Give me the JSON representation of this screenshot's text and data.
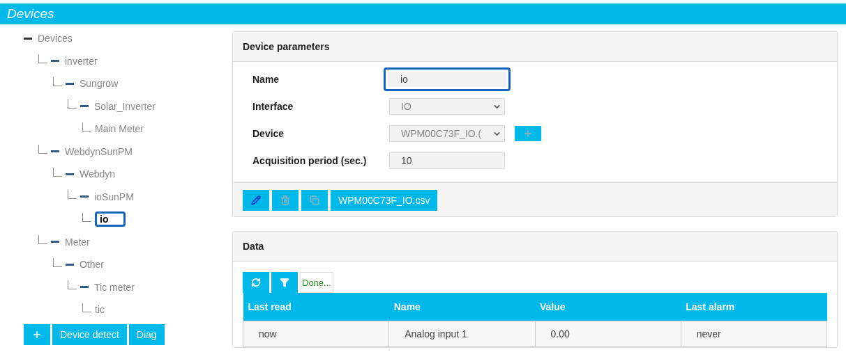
{
  "header": {
    "title": "Devices"
  },
  "tree": {
    "label": "Devices",
    "selected": false,
    "children": [
      {
        "label": "inverter",
        "selected": false,
        "children": [
          {
            "label": "Sungrow",
            "selected": false,
            "children": [
              {
                "label": "Solar_Inverter",
                "selected": false,
                "children": [
                  {
                    "label": "Main Meter",
                    "selected": false
                  }
                ]
              }
            ]
          }
        ]
      },
      {
        "label": "WebdynSunPM",
        "selected": false,
        "children": [
          {
            "label": "Webdyn",
            "selected": false,
            "children": [
              {
                "label": "ioSunPM",
                "selected": false,
                "children": [
                  {
                    "label": "io",
                    "selected": true
                  }
                ]
              }
            ]
          }
        ]
      },
      {
        "label": "Meter",
        "selected": false,
        "children": [
          {
            "label": "Other",
            "selected": false,
            "children": [
              {
                "label": "Tic meter",
                "selected": false,
                "children": [
                  {
                    "label": "tic",
                    "selected": false
                  }
                ]
              }
            ]
          }
        ]
      }
    ]
  },
  "tree_buttons": [
    {
      "kind": "add"
    },
    {
      "kind": "text",
      "label": "Device detect"
    },
    {
      "kind": "text",
      "label": "Diag"
    }
  ],
  "parameters": {
    "title": "Device parameters",
    "fields": [
      {
        "kind": "input",
        "label": "Name",
        "value": "io",
        "focused": true
      },
      {
        "kind": "select",
        "label": "Interface",
        "value": "IO",
        "focused": false
      },
      {
        "kind": "select_add",
        "label": "Device",
        "value": "WPM00C73F_IO.(",
        "focused": false
      },
      {
        "kind": "input",
        "label": "Acquisition period (sec.)",
        "value": "10",
        "focused": false
      }
    ],
    "actions": [
      {
        "kind": "edit"
      },
      {
        "kind": "delete"
      },
      {
        "kind": "copy"
      },
      {
        "kind": "text",
        "label": "WPM00C73F_IO.csv"
      }
    ]
  },
  "data": {
    "title": "Data",
    "status": "Done...",
    "columns": [
      "Last read",
      "Name",
      "Value",
      "Last alarm"
    ],
    "rows": [
      [
        "now",
        "Analog input 1",
        "0.00",
        "never"
      ]
    ]
  }
}
